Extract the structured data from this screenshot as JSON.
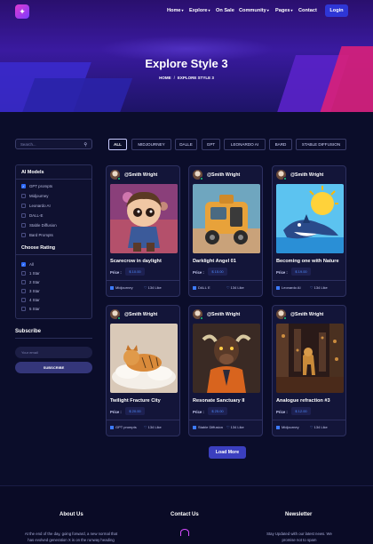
{
  "nav": {
    "items": [
      {
        "label": "Home",
        "caret": true
      },
      {
        "label": "Explore",
        "caret": true
      },
      {
        "label": "On Sale",
        "caret": false
      },
      {
        "label": "Community",
        "caret": true
      },
      {
        "label": "Pages",
        "caret": true
      },
      {
        "label": "Contact",
        "caret": false
      }
    ],
    "login_label": "Login"
  },
  "hero": {
    "title": "Explore Style 3",
    "breadcrumb": [
      "HOME",
      "EXPLORE STYLE 3"
    ],
    "breadcrumb_sep": "/"
  },
  "sidebar": {
    "search_placeholder": "Search...",
    "models_heading": "AI Models",
    "models": [
      {
        "label": "GPT prompts",
        "checked": true
      },
      {
        "label": "Midjourney",
        "checked": false
      },
      {
        "label": "Leonardo AI",
        "checked": false
      },
      {
        "label": "DALL-E",
        "checked": false
      },
      {
        "label": "Stable Diffusion",
        "checked": false
      },
      {
        "label": "Bard Prompts",
        "checked": false
      }
    ],
    "rating_heading": "Choose Rating",
    "ratings": [
      {
        "label": "All",
        "checked": true
      },
      {
        "label": "1 Star",
        "checked": false
      },
      {
        "label": "2 Star",
        "checked": false
      },
      {
        "label": "3 Star",
        "checked": false
      },
      {
        "label": "4 Star",
        "checked": false
      },
      {
        "label": "5 Star",
        "checked": false
      }
    ],
    "subscribe_heading": "Subscribe",
    "email_placeholder": "Your email",
    "subscribe_label": "SUBSCRIBE"
  },
  "tabs": [
    "ALL",
    "MIDJOURNEY",
    "DALLE",
    "GPT",
    "LEONARDO AI",
    "BARD",
    "STABLE DIFFUSION"
  ],
  "cards": [
    {
      "author": "@Smith Wright",
      "title": "Scarecrow in daylight",
      "price_label": "Price :",
      "price": "$ 10.00",
      "model": "Midjourney",
      "likes": "134 Like"
    },
    {
      "author": "@Smith Wright",
      "title": "Darklight Angel 01",
      "price_label": "Price :",
      "price": "$ 15.00",
      "model": "DALL E",
      "likes": "134 Like"
    },
    {
      "author": "@Smith Wright",
      "title": "Becoming one with Nature",
      "price_label": "Price :",
      "price": "$ 19.00",
      "model": "Leonardo AI",
      "likes": "134 Like"
    },
    {
      "author": "@Smith Wright",
      "title": "Twilight Fracture City",
      "price_label": "Price :",
      "price": "$ 20.00",
      "model": "GPT prompts",
      "likes": "134 Like"
    },
    {
      "author": "@Smith Wright",
      "title": "Resonate Sanctuary II",
      "price_label": "Price :",
      "price": "$ 25.00",
      "model": "Stable Diffusion",
      "likes": "134 Like"
    },
    {
      "author": "@Smith Wright",
      "title": "Analogue refraction #3",
      "price_label": "Price :",
      "price": "$ 12.00",
      "model": "Midjourney",
      "likes": "134 Like"
    }
  ],
  "load_more_label": "Load More",
  "footer": {
    "about_heading": "About Us",
    "about_text_1": "At the end of the day, going forward, a new normal that",
    "about_text_2": "has evolved generation X is on the runway heading",
    "contact_heading": "Contact Us",
    "newsletter_heading": "Newsletter",
    "newsletter_text_1": "Stay Updated with our latest news. We",
    "newsletter_text_2": "promise not to spam"
  },
  "colors": {
    "accent": "#2e36d6",
    "page_bg": "#0b0d2a",
    "price_text": "#4e8cff",
    "online_dot": "#1fd07a"
  }
}
